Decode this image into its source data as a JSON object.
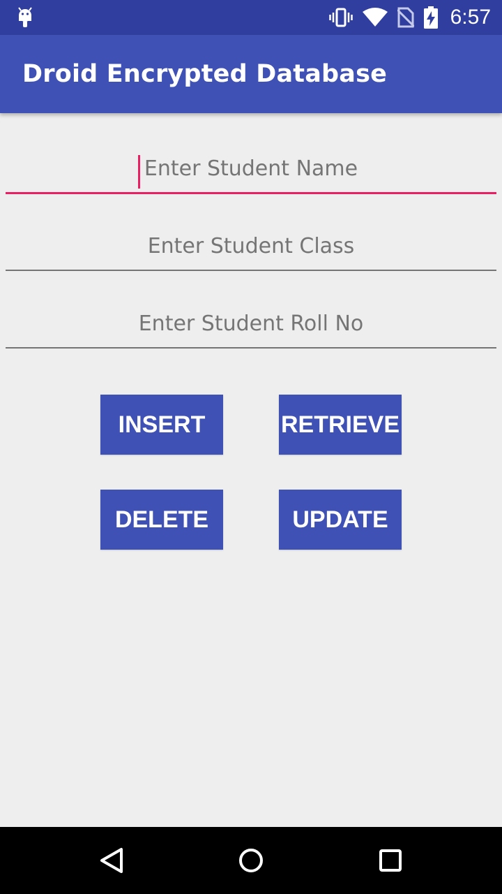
{
  "status_bar": {
    "time": "6:57",
    "icons": [
      "android-icon",
      "vibrate-icon",
      "wifi-icon",
      "no-sim-icon",
      "battery-charging-icon"
    ]
  },
  "app_bar": {
    "title": "Droid Encrypted Database"
  },
  "form": {
    "student_name": {
      "placeholder": "Enter Student Name",
      "value": ""
    },
    "student_class": {
      "placeholder": "Enter Student Class",
      "value": ""
    },
    "student_roll": {
      "placeholder": "Enter Student Roll No",
      "value": ""
    }
  },
  "buttons": {
    "insert": "INSERT",
    "retrieve": "RETRIEVE",
    "delete": "DELETE",
    "update": "UPDATE"
  },
  "nav_bar": {
    "icons": [
      "back-icon",
      "home-icon",
      "recents-icon"
    ]
  },
  "colors": {
    "status_bar": "#303f9f",
    "primary": "#3f51b5",
    "accent": "#e91e63",
    "background": "#eeeeee"
  }
}
